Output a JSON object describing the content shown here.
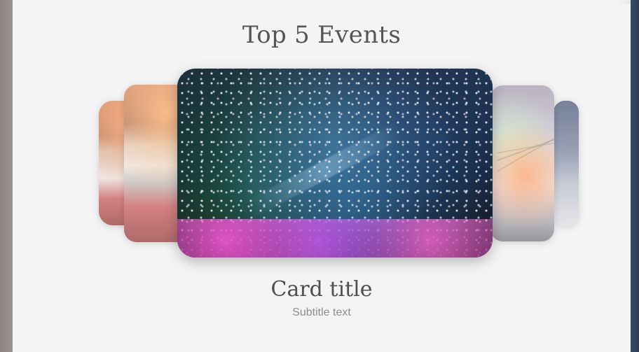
{
  "page": {
    "title": "Top 5 Events"
  },
  "carousel": {
    "cards": [
      {
        "slot": "left-far",
        "image": "conference-audience"
      },
      {
        "slot": "left-near",
        "image": "conference-audience"
      },
      {
        "slot": "center",
        "image": "confetti-concert"
      },
      {
        "slot": "right-near",
        "image": "outdoor-dinner-party"
      },
      {
        "slot": "right-far",
        "image": "blue-dusk-scene"
      }
    ],
    "active_card": {
      "title": "Card title",
      "subtitle": "Subtitle text"
    }
  },
  "colors": {
    "page_bg": "#f4f4f4",
    "left_bezel": "#8f8785",
    "right_edge": "#3b4a66",
    "title_text": "#555555",
    "subtitle_text": "#8d8d8d"
  }
}
